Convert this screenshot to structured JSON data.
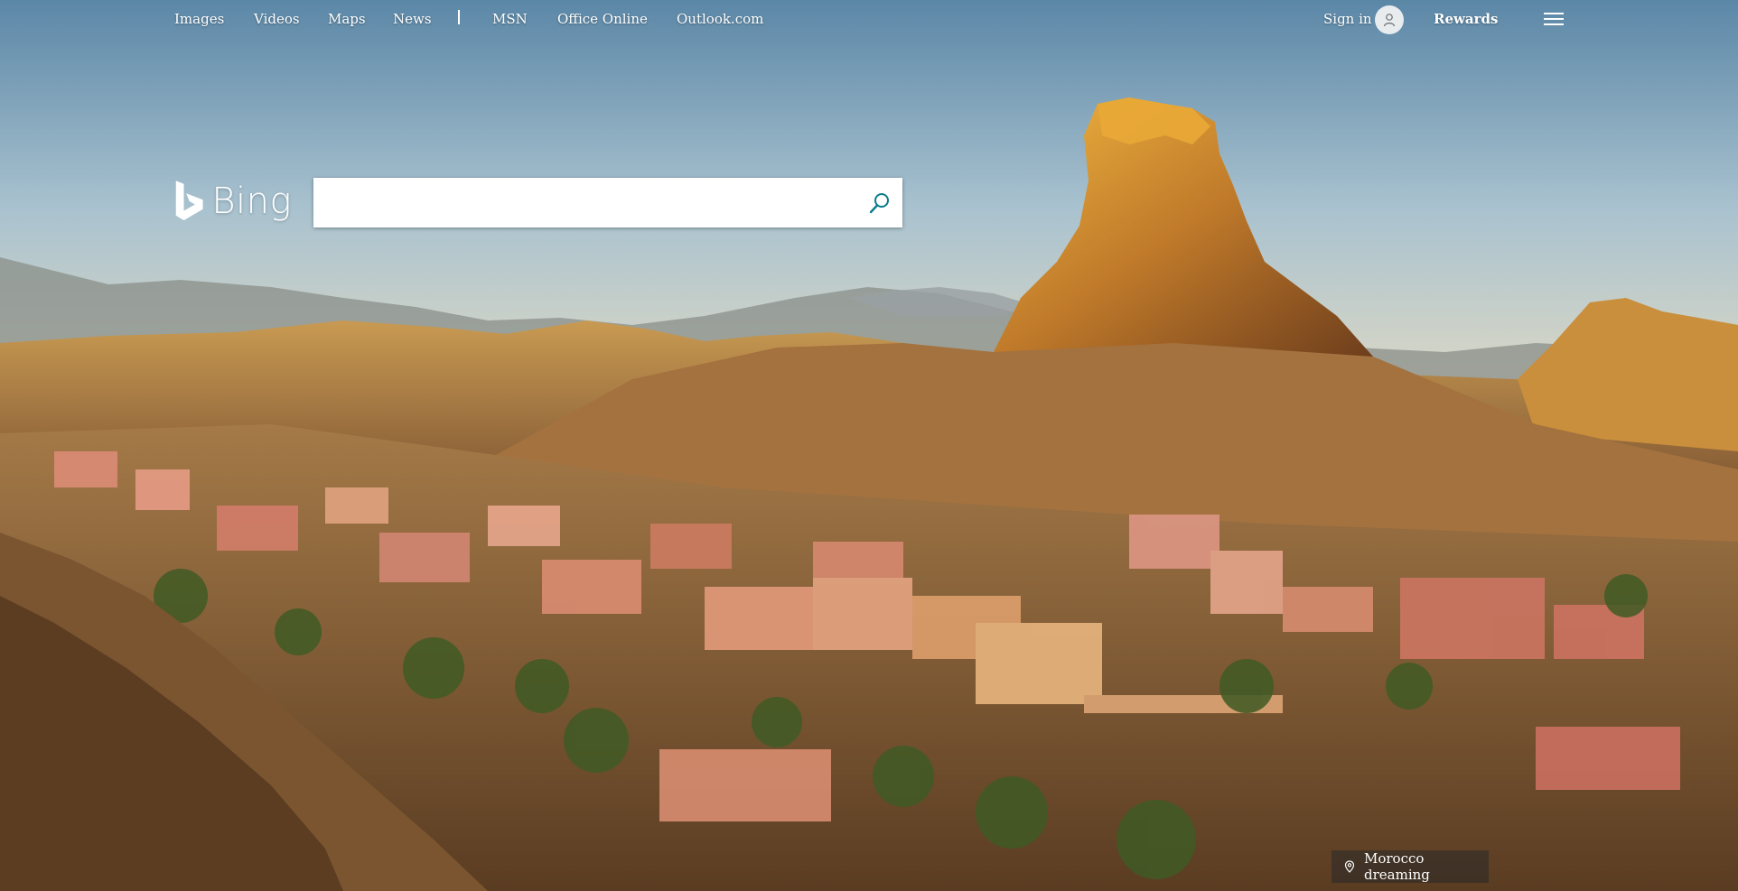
{
  "nav": {
    "left_links": [
      "Images",
      "Videos",
      "Maps",
      "News"
    ],
    "right_links": [
      "MSN",
      "Office Online",
      "Outlook.com"
    ],
    "signin_label": "Sign in",
    "rewards_label": "Rewards"
  },
  "logo": {
    "text": "Bing"
  },
  "search": {
    "value": "",
    "placeholder": ""
  },
  "background": {
    "caption": "Morocco dreaming"
  },
  "icons": {
    "avatar": "user-avatar-icon",
    "menu": "hamburger-menu-icon",
    "search": "search-icon",
    "location": "location-pin-icon",
    "logo": "bing-logo-icon"
  },
  "colors": {
    "search_icon": "#0c7c8c",
    "caption_bg": "#2a2a2a"
  }
}
